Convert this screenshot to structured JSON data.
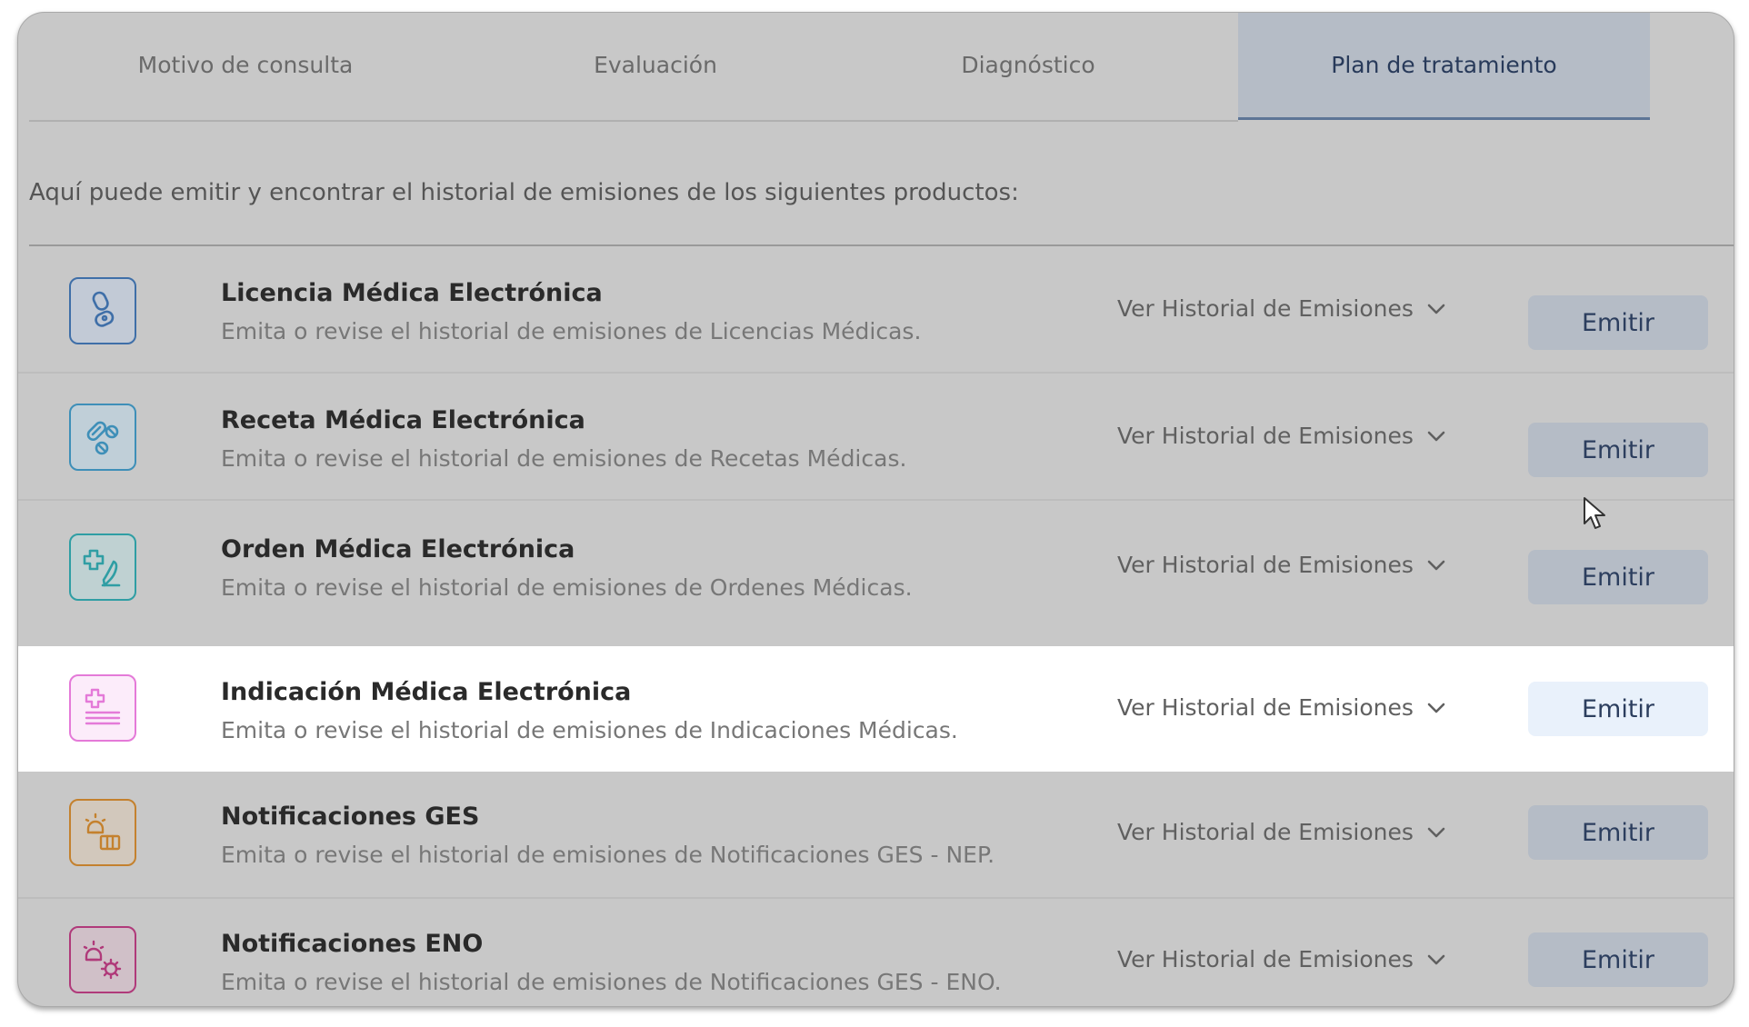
{
  "tabs": [
    {
      "label": "Motivo de consulta"
    },
    {
      "label": "Evaluación"
    },
    {
      "label": "Diagnóstico"
    },
    {
      "label": "Plan de tratamiento"
    }
  ],
  "intro_text": "Aquí puede emitir y encontrar el historial de emisiones de los siguientes productos:",
  "products": [
    {
      "title": "Licencia Médica Electrónica",
      "description": "Emita o revise el historial de emisiones de Licencias Médicas.",
      "history_label": "Ver Historial de Emisiones",
      "emit_label": "Emitir",
      "icon": "bandage-icon",
      "color": "#3f6fa8"
    },
    {
      "title": "Receta Médica Electrónica",
      "description": "Emita o revise el historial de emisiones de Recetas Médicas.",
      "history_label": "Ver Historial de Emisiones",
      "emit_label": "Emitir",
      "icon": "pills-icon",
      "color": "#3e8fb8"
    },
    {
      "title": "Orden Médica Electrónica",
      "description": "Emita o revise el historial de emisiones de Ordenes Médicas.",
      "history_label": "Ver Historial de Emisiones",
      "emit_label": "Emitir",
      "icon": "medical-order-icon",
      "color": "#2f9ea4"
    },
    {
      "title": "Indicación Médica Electrónica",
      "description": "Emita o revise el historial de emisiones de Indicaciones Médicas.",
      "history_label": "Ver Historial de Emisiones",
      "emit_label": "Emitir",
      "icon": "medical-indication-icon",
      "color": "#e47ad8"
    },
    {
      "title": "Notificaciones GES",
      "description": "Emita o revise el historial de emisiones de Notificaciones GES - NEP.",
      "history_label": "Ver Historial de Emisiones",
      "emit_label": "Emitir",
      "icon": "notification-ges-icon",
      "color": "#c4812e"
    },
    {
      "title": "Notificaciones ENO",
      "description": "Emita o revise el historial de emisiones de Notificaciones GES - ENO.",
      "history_label": "Ver Historial de Emisiones",
      "emit_label": "Emitir",
      "icon": "notification-eno-icon",
      "color": "#b03a7a"
    }
  ]
}
